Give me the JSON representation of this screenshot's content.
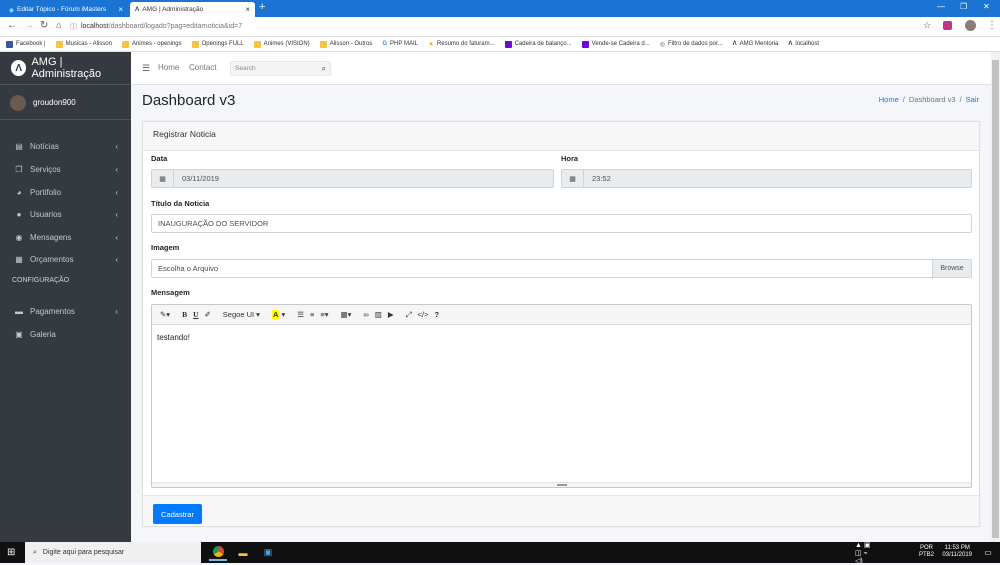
{
  "browser": {
    "tabs": [
      {
        "title": "Editar Tópico - Fórum iMasters",
        "active": false
      },
      {
        "title": "AMG | Administração",
        "active": true
      }
    ],
    "url_host": "localhost",
    "url_path": "/dashboard/logado?pag=editarnoticia&id=7",
    "bookmarks": [
      "Facebook |",
      "Musicas - Alisson",
      "Animes - openings",
      "Openings FULL",
      "Animes (VISION)",
      "Alisson - Outros",
      "PHP MAIL",
      "Resumo do faturam...",
      "Cadeira de balanço...",
      "Vende-se Cadeira d...",
      "Filtro de dados por...",
      "AMG Mentoria",
      "localhost"
    ]
  },
  "sidebar": {
    "brand": "AMG | Administração",
    "user": "groudon900",
    "items": [
      {
        "label": "Notícias",
        "icon": "newspaper-icon",
        "glyph": "▤",
        "chevron": true
      },
      {
        "label": "Serviços",
        "icon": "copy-icon",
        "glyph": "❐",
        "chevron": true
      },
      {
        "label": "Portifolio",
        "icon": "chart-pie-icon",
        "glyph": "◕",
        "chevron": true
      },
      {
        "label": "Usuarios",
        "icon": "user-circle-icon",
        "glyph": "●",
        "chevron": true
      },
      {
        "label": "Mensagens",
        "icon": "comments-icon",
        "glyph": "◉",
        "chevron": true
      },
      {
        "label": "Orçamentos",
        "icon": "table-icon",
        "glyph": "▦",
        "chevron": true
      }
    ],
    "section_header": "CONFIGURAÇÃO",
    "config_items": [
      {
        "label": "Pagamentos",
        "icon": "credit-card-icon",
        "glyph": "▬",
        "chevron": true
      },
      {
        "label": "Galeria",
        "icon": "image-icon",
        "glyph": "▣",
        "chevron": false
      }
    ]
  },
  "topnav": {
    "home": "Home",
    "contact": "Contact",
    "search_placeholder": "Search"
  },
  "page": {
    "title": "Dashboard v3",
    "breadcrumb": [
      "Home",
      "Dashboard v3",
      "Sair"
    ]
  },
  "form": {
    "card_title": "Registrar Noticia",
    "data_label": "Data",
    "data_value": "03/11/2019",
    "hora_label": "Hora",
    "hora_value": "23:52",
    "titulo_label": "Título da Noticia",
    "titulo_value": "INAUGURAÇÃO DO SERVIDOR",
    "imagem_label": "Imagem",
    "imagem_value": "Escolha o Arquivo",
    "browse_label": "Browse",
    "mensagem_label": "Mensagem",
    "editor_font": "Segoe UI",
    "editor_content": "testando!",
    "submit_label": "Cadastrar"
  },
  "taskbar": {
    "search_placeholder": "Digite aqui para pesquisar",
    "lang_top": "POR",
    "lang_bottom": "PTB2",
    "time": "11:53 PM",
    "date": "03/11/2019"
  },
  "colors": {
    "primary": "#007bff",
    "sidebar_bg": "#343a40",
    "chrome_blue": "#1b73d4"
  }
}
